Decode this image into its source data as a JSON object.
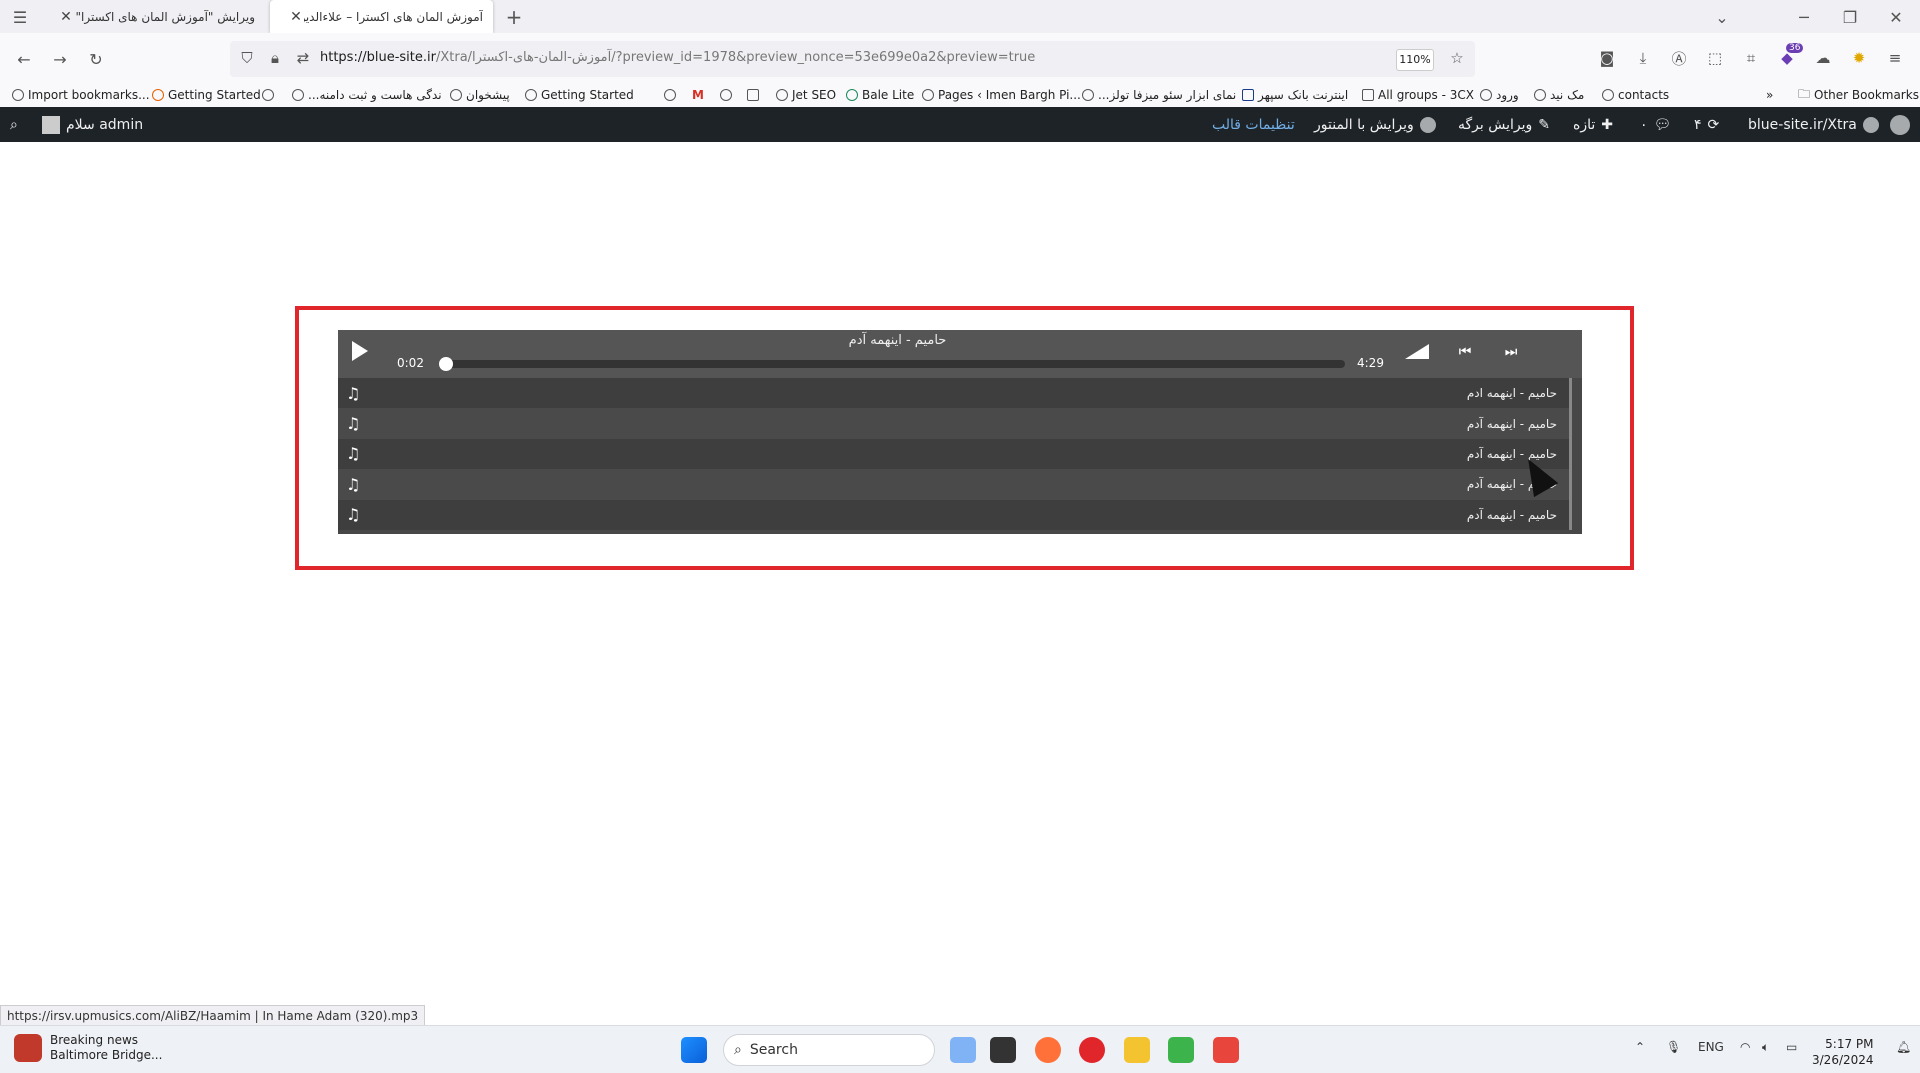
{
  "browser": {
    "tabs": [
      {
        "title": "ویرایش \"آموزش المان های اکسترا\" ‹ علا",
        "active": false
      },
      {
        "title": "آموزش المان های اکسترا – علاءالدین",
        "active": true
      }
    ],
    "new_tab": "+",
    "url_domain": "https://blue-site.ir",
    "url_path": "/Xtra/آموزش-المان-های-اکسترا/?preview_id=1978&preview_nonce=53e699e0a2&preview=true",
    "zoom": "110%",
    "extension_badge": "36",
    "bookmarks": [
      "Import bookmarks...",
      "Getting Started",
      "...ندگی هاست و ثبت دامنه",
      "پیشخوان",
      "Getting Started",
      "Jet SEO",
      "Bale Lite",
      "Pages ‹ Imen Bargh Pi...",
      "...نمای ابزار سئو میزفا تولز",
      "اینترنت بانک سپهر",
      "All groups - 3CX",
      "ورود",
      "مک نید",
      "contacts"
    ],
    "other_bookmarks": "Other Bookmarks",
    "status_url": "https://irsv.upmusics.com/AliBZ/Haamim | In Hame Adam (320).mp3"
  },
  "wp_admin_bar": {
    "site": "blue-site.ir/Xtra",
    "updates": "۴",
    "comments": "۰",
    "new": "تازه",
    "edit_page": "ویرایش برگه",
    "edit_elementor": "ویرایش با المنتور",
    "theme_settings": "تنظیمات قالب",
    "greeting": "سلام admin"
  },
  "player": {
    "current_title": "حامیم - اینهمه آدم",
    "current_time": "0:02",
    "duration": "4:29",
    "progress": 0.007,
    "tracks": [
      "حامیم - اینهمه ادم",
      "حامیم - اینهمه آدم",
      "حامیم - اینهمه آدم",
      "حامیم - اینهمه آدم",
      "حامیم - اینهمه آدم"
    ]
  },
  "taskbar": {
    "news_title": "Breaking news",
    "news_sub": "Baltimore Bridge...",
    "search": "Search",
    "lang": "ENG",
    "time": "5:17 PM",
    "date": "3/26/2024"
  }
}
